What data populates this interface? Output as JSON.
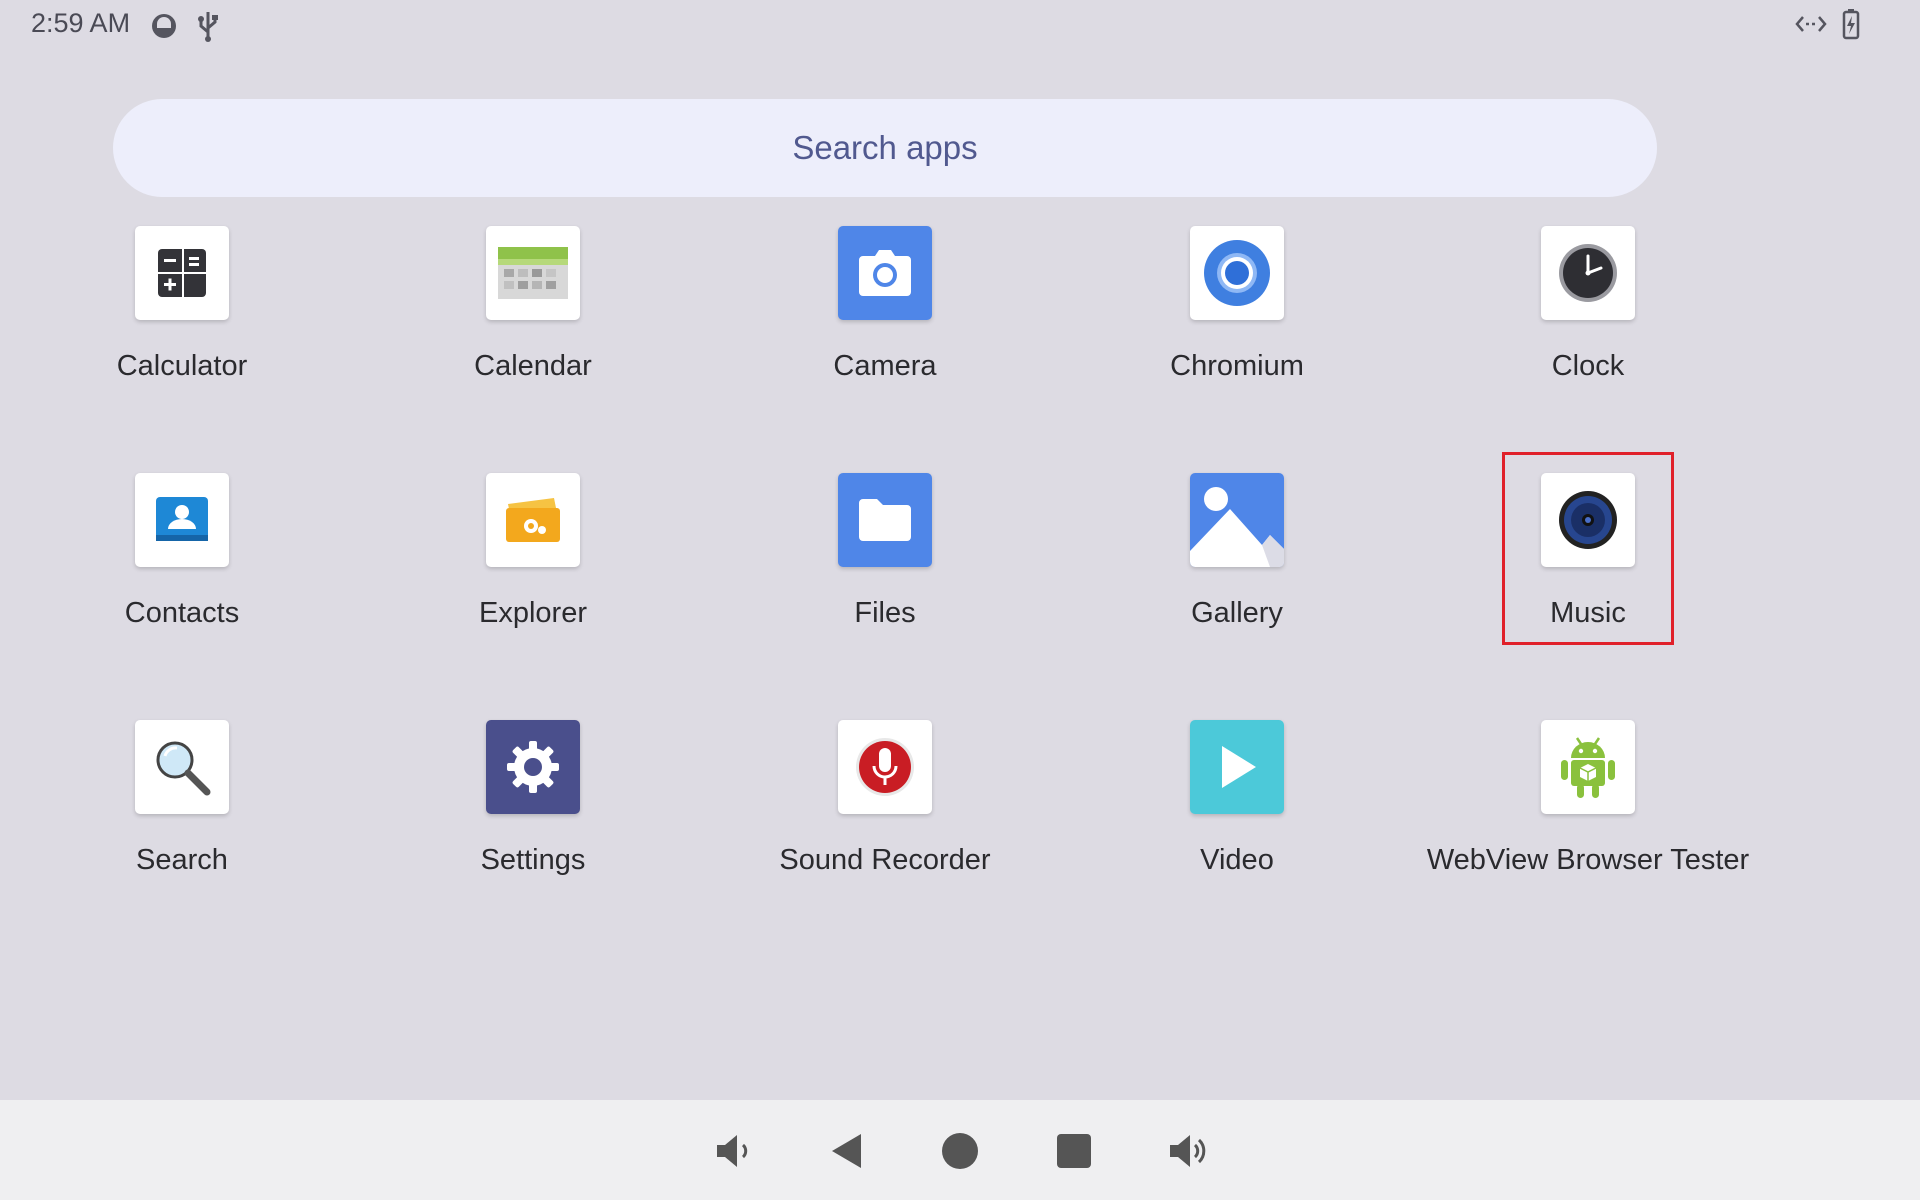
{
  "status_bar": {
    "time": "2:59 AM",
    "left_icons": [
      "sync-icon",
      "usb-icon"
    ],
    "right_icons": [
      "data-transfer-icon",
      "battery-charging-icon"
    ]
  },
  "search": {
    "placeholder": "Search apps"
  },
  "apps": [
    {
      "label": "Calculator",
      "icon": "calculator-icon"
    },
    {
      "label": "Calendar",
      "icon": "calendar-icon"
    },
    {
      "label": "Camera",
      "icon": "camera-icon"
    },
    {
      "label": "Chromium",
      "icon": "chromium-icon"
    },
    {
      "label": "Clock",
      "icon": "clock-icon"
    },
    {
      "label": "Contacts",
      "icon": "contacts-icon"
    },
    {
      "label": "Explorer",
      "icon": "explorer-icon"
    },
    {
      "label": "Files",
      "icon": "files-icon"
    },
    {
      "label": "Gallery",
      "icon": "gallery-icon"
    },
    {
      "label": "Music",
      "icon": "music-icon"
    },
    {
      "label": "Search",
      "icon": "search-icon"
    },
    {
      "label": "Settings",
      "icon": "settings-icon"
    },
    {
      "label": "Sound Recorder",
      "icon": "microphone-icon"
    },
    {
      "label": "Video",
      "icon": "video-play-icon"
    },
    {
      "label": "WebView Browser Tester",
      "icon": "android-icon"
    }
  ],
  "highlighted_app": "Music",
  "nav_bar": [
    "volume-down-icon",
    "back-icon",
    "home-icon",
    "recents-icon",
    "volume-up-icon"
  ],
  "colors": {
    "background": "#dddbe3",
    "search_bg": "#edeefb",
    "search_text": "#51598f",
    "highlight": "#e0202a",
    "nav_bg": "#efeff1"
  }
}
